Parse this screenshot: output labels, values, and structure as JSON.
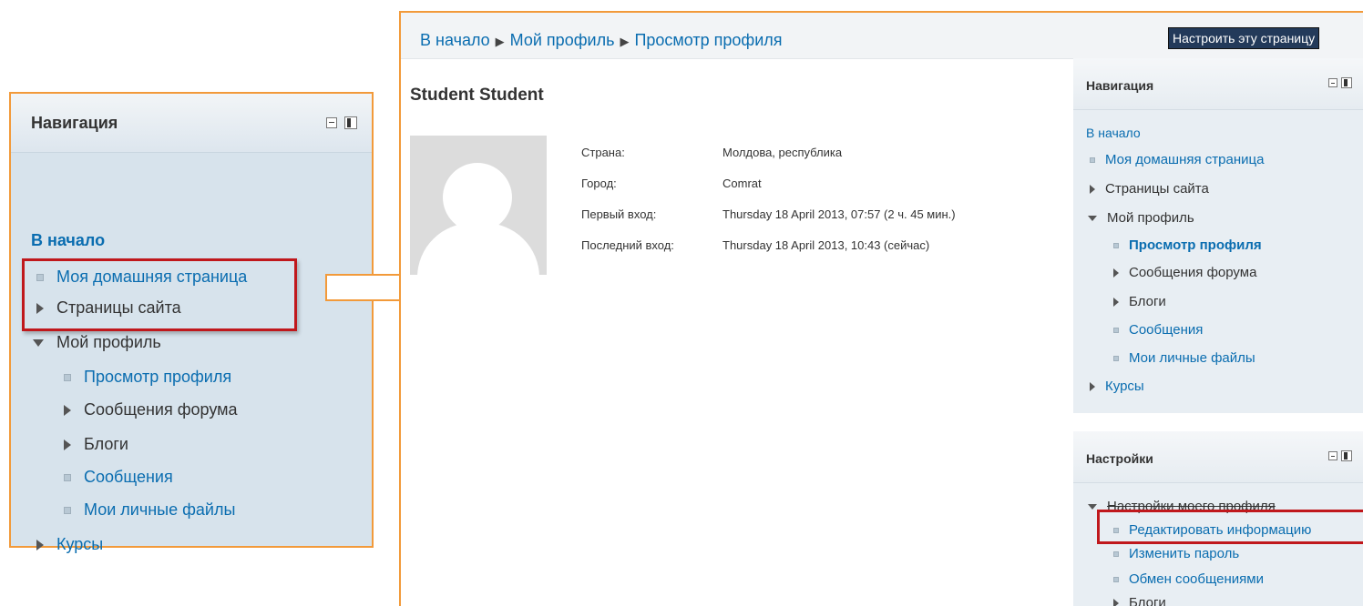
{
  "left_nav": {
    "title": "Навигация",
    "home": "В начало",
    "items": [
      {
        "label": "Моя домашняя страница",
        "kind": "bullet-link"
      },
      {
        "label": "Страницы сайта",
        "kind": "collapsed"
      },
      {
        "label": "Мой профиль",
        "kind": "expanded"
      },
      {
        "label": "Просмотр профиля",
        "kind": "bullet-link"
      },
      {
        "label": "Сообщения форума",
        "kind": "collapsed"
      },
      {
        "label": "Блоги",
        "kind": "collapsed"
      },
      {
        "label": "Сообщения",
        "kind": "bullet-link"
      },
      {
        "label": "Мои личные файлы",
        "kind": "bullet-link"
      },
      {
        "label": "Курсы",
        "kind": "collapsed"
      }
    ]
  },
  "main": {
    "breadcrumb": [
      "В начало",
      "Мой профиль",
      "Просмотр профиля"
    ],
    "customize_button": "Настроить эту страницу",
    "profile_name": "Student Student",
    "info": [
      {
        "key": "Страна:",
        "value": "Молдова, республика"
      },
      {
        "key": "Город:",
        "value": "Comrat"
      },
      {
        "key": "Первый вход:",
        "value": "Thursday 18 April 2013, 07:57  (2 ч. 45 мин.)"
      },
      {
        "key": "Последний вход:",
        "value": "Thursday 18 April 2013, 10:43  (сейчас)"
      }
    ]
  },
  "side_nav": {
    "title": "Навигация",
    "home": "В начало",
    "items": [
      {
        "label": "Моя домашняя страница"
      },
      {
        "label": "Страницы сайта"
      },
      {
        "label": "Мой профиль"
      },
      {
        "label": "Просмотр профиля"
      },
      {
        "label": "Сообщения форума"
      },
      {
        "label": "Блоги"
      },
      {
        "label": "Сообщения"
      },
      {
        "label": "Мои личные файлы"
      },
      {
        "label": "Курсы"
      }
    ]
  },
  "side_settings": {
    "title": "Настройки",
    "items": [
      {
        "label": "Настройки моего профиля"
      },
      {
        "label": "Редактировать информацию"
      },
      {
        "label": "Изменить пароль"
      },
      {
        "label": "Обмен сообщениями"
      },
      {
        "label": "Блоги"
      }
    ]
  },
  "colors": {
    "highlight": "#c0181c",
    "frame": "#f29a3a",
    "link": "#0a6db0",
    "arrow_fill": "#ffffff"
  }
}
